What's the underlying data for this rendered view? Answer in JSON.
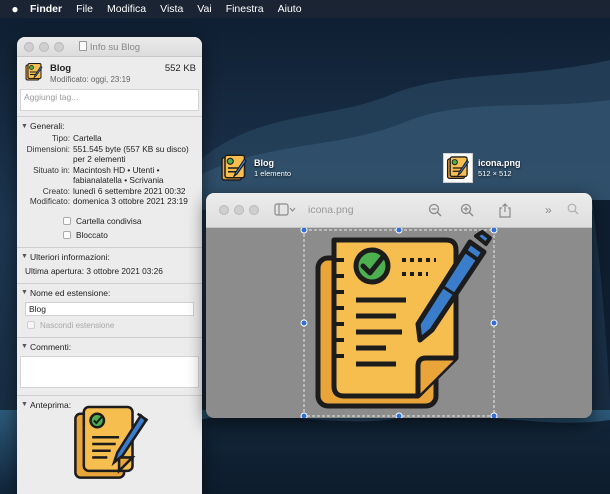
{
  "menubar": {
    "apple": "",
    "items": [
      "Finder",
      "File",
      "Modifica",
      "Vista",
      "Vai",
      "Finestra",
      "Aiuto"
    ]
  },
  "info_window": {
    "title": "Info su Blog",
    "file_name": "Blog",
    "file_size": "552 KB",
    "modified": "Modificato: oggi, 23:19",
    "tags_placeholder": "Aggiungi tag...",
    "general": {
      "header": "Generali:",
      "rows": [
        {
          "k": "Tipo:",
          "v": "Cartella"
        },
        {
          "k": "Dimensioni:",
          "v": "551.545 byte (557 KB su disco)"
        },
        {
          "k": "",
          "v": "per 2 elementi"
        },
        {
          "k": "Situato in:",
          "v": "Macintosh HD • Utenti •"
        },
        {
          "k": "",
          "v": "fabianalatella • Scrivania"
        },
        {
          "k": "Creato:",
          "v": "lunedì 6 settembre 2021 00:32"
        },
        {
          "k": "Modificato:",
          "v": "domenica 3 ottobre 2021 23:19"
        }
      ],
      "shared_label": "Cartella condivisa",
      "locked_label": "Bloccato"
    },
    "more_info": {
      "header": "Ulteriori informazioni:",
      "last_opened": "Ultima apertura: 3 ottobre 2021 03:26"
    },
    "name_ext": {
      "header": "Nome ed estensione:",
      "value": "Blog",
      "hide_ext_label": "Nascondi estensione"
    },
    "comments": {
      "header": "Commenti:"
    },
    "preview": {
      "header": "Anteprima:"
    }
  },
  "desktop": {
    "blog_folder": {
      "name": "Blog",
      "sub": "1 elemento"
    },
    "icona_file": {
      "name": "icona.png",
      "sub": "512 × 512"
    }
  },
  "preview_window": {
    "filename": "icona.png",
    "toolbar_icons": [
      "sidebar-icon",
      "zoom-out-icon",
      "zoom-in-icon",
      "share-icon",
      "more-icon",
      "search-icon"
    ]
  },
  "colors": {
    "paper_yellow": "#f6bd4f",
    "paper_orange": "#e9a43a",
    "outline": "#1c1c1c",
    "pen_blue": "#3a7ecb",
    "check_green": "#4caf50",
    "selection_handle": "#2f6fdc"
  }
}
